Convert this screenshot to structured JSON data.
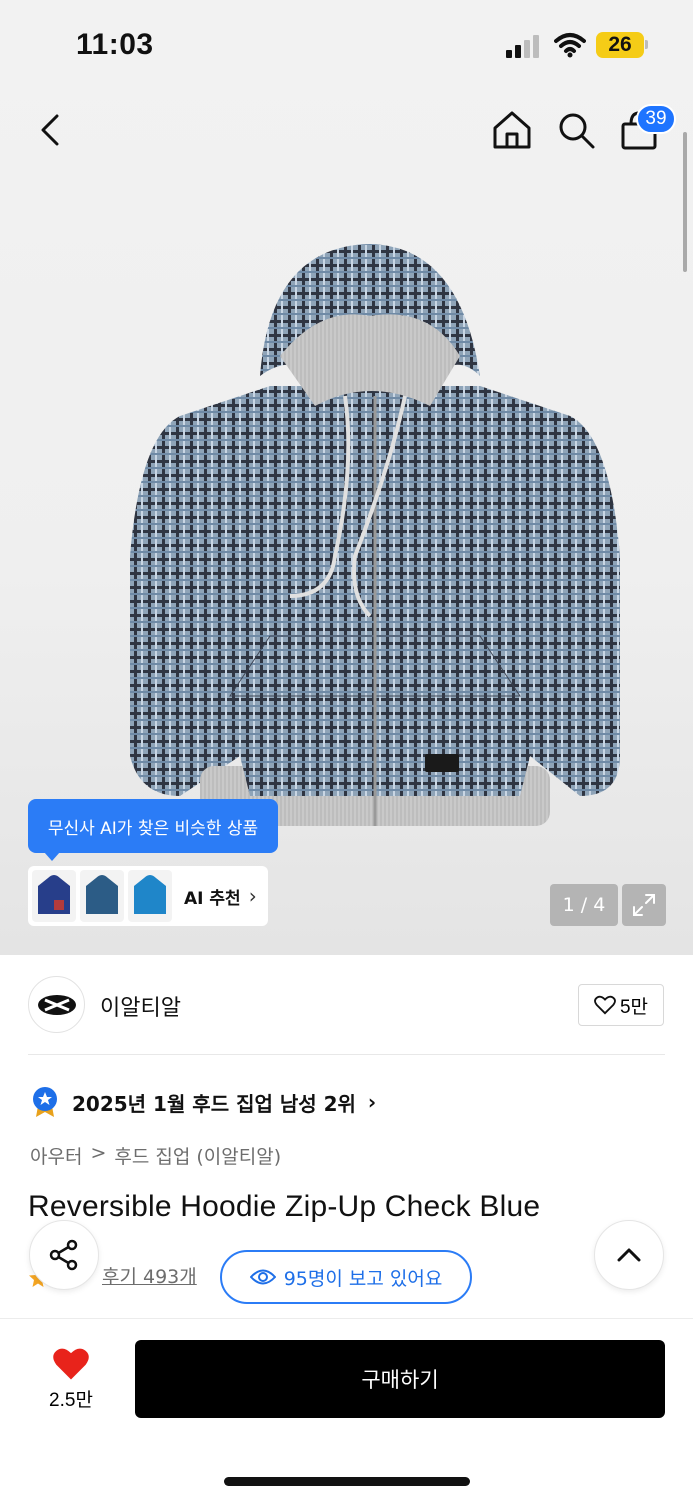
{
  "status_bar": {
    "time": "11:03",
    "battery": "26"
  },
  "header": {
    "cart_count": "39"
  },
  "gallery": {
    "ai_tooltip": "무신사 AI가 찾은 비슷한 상품",
    "ai_label": "AI 추천",
    "counter": "1 / 4"
  },
  "brand": {
    "name": "이알티알",
    "likes": "5만"
  },
  "ranking": {
    "text": "2025년 1월 후드 집업 남성 2위"
  },
  "breadcrumb": {
    "category": "아우터",
    "separator": ">",
    "subcategory": "후드 집업 (이알티알)"
  },
  "product": {
    "title": "Reversible Hoodie Zip-Up Check Blue"
  },
  "reviews": {
    "link": "후기 493개",
    "viewers": "95명이 보고 있어요"
  },
  "bottom_bar": {
    "wish_count": "2.5만",
    "buy_label": "구매하기"
  },
  "colors": {
    "accent": "#2b7cf6",
    "badge": "#1e74ff",
    "wish": "#e8231b",
    "buy_bg": "#000000"
  }
}
